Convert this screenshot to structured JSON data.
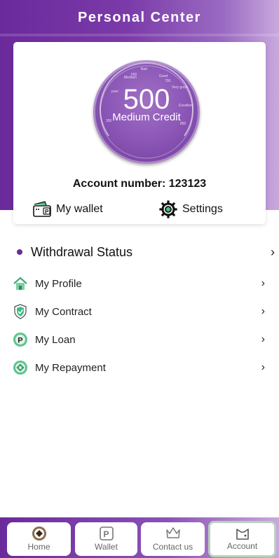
{
  "header": {
    "title": "Personal Center"
  },
  "credit": {
    "score": "500",
    "level": "Medium Credit",
    "ring_labels": [
      "Bad",
      "poor",
      "Medium",
      "Good",
      "Very good",
      "Excellent",
      "350",
      "500",
      "650",
      "700",
      "850"
    ]
  },
  "account": {
    "text": "Account number: 123123"
  },
  "quick_links": {
    "wallet": "My wallet",
    "settings": "Settings"
  },
  "menu": {
    "withdrawal": "Withdrawal Status",
    "items": [
      {
        "label": "My Profile",
        "icon": "home-icon"
      },
      {
        "label": "My Contract",
        "icon": "shield-check-icon"
      },
      {
        "label": "My Loan",
        "icon": "p-coin-icon"
      },
      {
        "label": "My Repayment",
        "icon": "repayment-icon"
      }
    ]
  },
  "tabs": {
    "home": "Home",
    "wallet": "Wallet",
    "contact": "Contact us",
    "account": "Account",
    "active": "account"
  },
  "colors": {
    "brand": "#6b2a9c",
    "gauge": "#8d58b8",
    "accent_green": "#3fbf82"
  }
}
